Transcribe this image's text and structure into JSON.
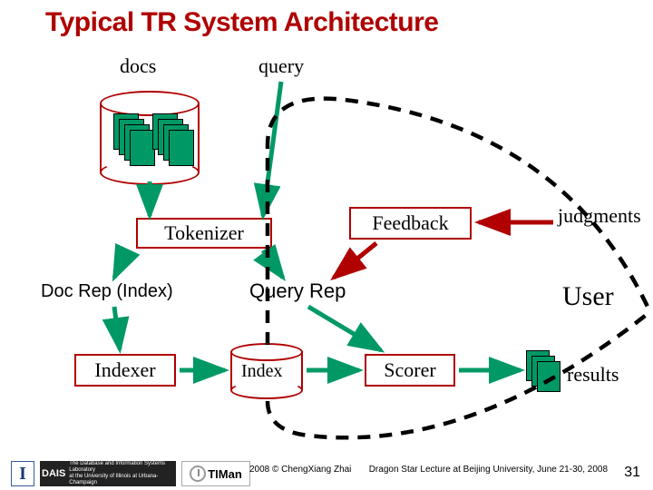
{
  "title": "Typical TR System Architecture",
  "labels": {
    "docs": "docs",
    "query": "query",
    "judgments": "judgments",
    "user": "User",
    "results": "results",
    "doc_rep": "Doc Rep (Index)",
    "query_rep": "Query Rep"
  },
  "boxes": {
    "tokenizer": "Tokenizer",
    "feedback": "Feedback",
    "indexer": "Indexer",
    "index": "Index",
    "scorer": "Scorer"
  },
  "footer": {
    "copyright": "2008 © ChengXiang Zhai",
    "venue": "Dragon Star Lecture at Beijing University, June 21-30, 2008",
    "pagenum": "31",
    "logo_i_text": "I",
    "logo_dais_text": "DAIS",
    "logo_timan_text": "TIMan"
  },
  "colors": {
    "title": "#b00000",
    "box_border": "#b00000",
    "fill_green": "#009966",
    "arrow_green": "#009966",
    "arrow_red": "#b00000"
  }
}
